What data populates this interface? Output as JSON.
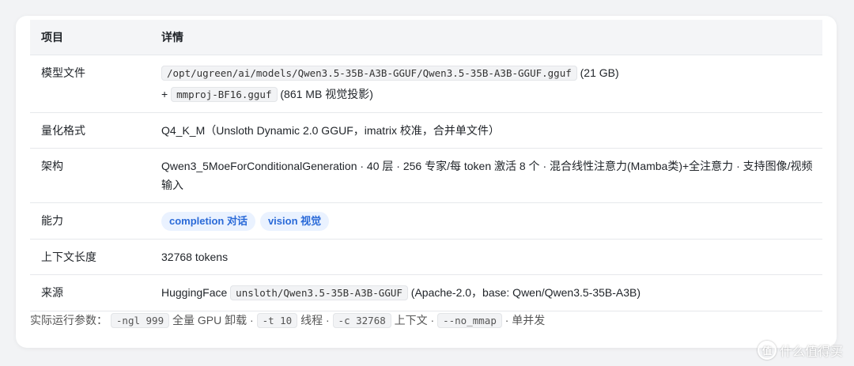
{
  "table": {
    "header": {
      "key": "项目",
      "value": "详情"
    },
    "rows": {
      "model_file": {
        "key": "模型文件",
        "path": "/opt/ugreen/ai/models/Qwen3.5-35B-A3B-GGUF/Qwen3.5-35B-A3B-GGUF.gguf",
        "size": "(21 GB)",
        "plus": "+",
        "proj": "mmproj-BF16.gguf",
        "proj_note": "(861 MB 视觉投影)"
      },
      "quant": {
        "key": "量化格式",
        "value": "Q4_K_M（Unsloth Dynamic 2.0 GGUF，imatrix 校准，合并单文件）"
      },
      "arch": {
        "key": "架构",
        "value": "Qwen3_5MoeForConditionalGeneration · 40 层 · 256 专家/每 token 激活 8 个 · 混合线性注意力(Mamba类)+全注意力 · 支持图像/视频输入"
      },
      "capability": {
        "key": "能力",
        "badges": [
          "completion 对话",
          "vision 视觉"
        ]
      },
      "context": {
        "key": "上下文长度",
        "value": "32768 tokens"
      },
      "source": {
        "key": "来源",
        "prefix": "HuggingFace",
        "repo": "unsloth/Qwen3.5-35B-A3B-GGUF",
        "suffix": "(Apache-2.0，base: Qwen/Qwen3.5-35B-A3B)"
      }
    }
  },
  "footer": {
    "label": "实际运行参数：",
    "params": [
      {
        "code": "-ngl 999",
        "desc": "全量 GPU 卸载 ·"
      },
      {
        "code": "-t 10",
        "desc": "线程 ·"
      },
      {
        "code": "-c 32768",
        "desc": "上下文 ·"
      },
      {
        "code": "--no_mmap",
        "desc": "· 单并发"
      }
    ]
  },
  "watermark": {
    "text": "什么值得买",
    "icon": "smzdm-logo-icon",
    "logo_char": "值"
  },
  "colors": {
    "badge_bg": "#eaf2ff",
    "badge_text": "#2a6ad8",
    "header_bg": "#f4f5f7"
  }
}
